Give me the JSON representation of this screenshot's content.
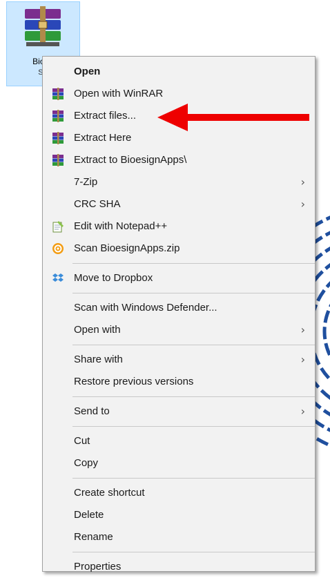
{
  "desktop": {
    "file_name": "Bioesi",
    "file_subtext": "S..."
  },
  "menu": {
    "items": [
      {
        "label": "Open",
        "bold": true
      },
      {
        "label": "Open with WinRAR",
        "icon": "winrar-icon"
      },
      {
        "label": "Extract files...",
        "icon": "winrar-icon"
      },
      {
        "label": "Extract Here",
        "icon": "winrar-icon"
      },
      {
        "label": "Extract to BioesignApps\\",
        "icon": "winrar-icon"
      },
      {
        "label": "7-Zip",
        "submenu": true
      },
      {
        "label": "CRC SHA",
        "submenu": true
      },
      {
        "label": "Edit with Notepad++",
        "icon": "notepad-plus-plus-icon"
      },
      {
        "label": "Scan BioesignApps.zip",
        "icon": "scanner-icon"
      },
      {
        "label": "Move to Dropbox",
        "icon": "dropbox-icon"
      },
      {
        "label": "Scan with Windows Defender..."
      },
      {
        "label": "Open with",
        "submenu": true
      },
      {
        "label": "Share with",
        "submenu": true
      },
      {
        "label": "Restore previous versions"
      },
      {
        "label": "Send to",
        "submenu": true
      },
      {
        "label": "Cut"
      },
      {
        "label": "Copy"
      },
      {
        "label": "Create shortcut"
      },
      {
        "label": "Delete"
      },
      {
        "label": "Rename"
      },
      {
        "label": "Properties"
      }
    ],
    "submenu_arrow": "›"
  },
  "colors": {
    "selection": "#cce8ff",
    "menu_bg": "#f2f2f2",
    "annotation_arrow": "#ee0000"
  }
}
